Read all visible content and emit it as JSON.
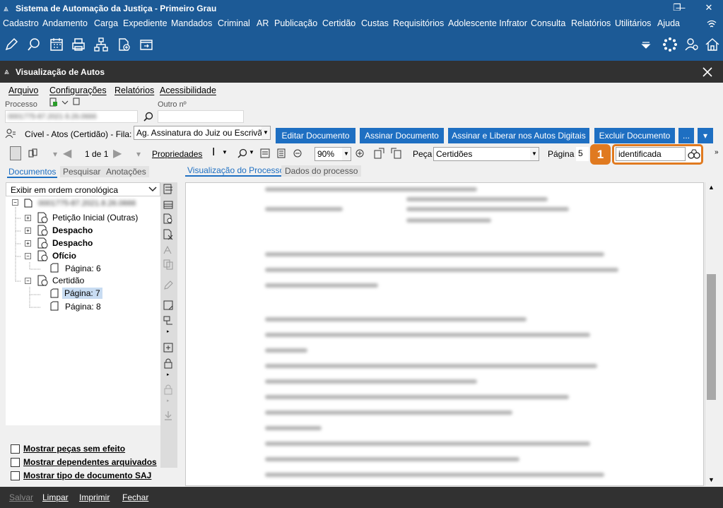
{
  "window": {
    "title": "Sistema de Automação da Justiça - Primeiro Grau",
    "logo_glyph": "⩓"
  },
  "menubar": [
    "Cadastro",
    "Andamento",
    "Carga",
    "Expediente",
    "Mandados",
    "Criminal",
    "AR",
    "Publicação",
    "Certidão",
    "Custas",
    "Requisitórios",
    "Adolescente Infrator",
    "Consulta",
    "Relatórios",
    "Utilitários",
    "Ajuda"
  ],
  "inner_window": {
    "title": "Visualização de Autos"
  },
  "inner_menu": [
    "Arquivo",
    "Configurações",
    "Relatórios",
    "Acessibilidade"
  ],
  "processo": {
    "label": "Processo",
    "value_blurred": "0001775-87.2021 8.26.0666",
    "outro_label": "Outro nº",
    "outro_value": ""
  },
  "fila": {
    "prefix": "Cível - Atos (Certidão) - Fila:",
    "selected": "Ag. Assinatura do Juiz ou Escrivão"
  },
  "action_buttons": {
    "editar": "Editar Documento",
    "assinar": "Assinar Documento",
    "assinar_liberar": "Assinar e Liberar nos Autos Digitais",
    "excluir": "Excluir Documento",
    "more": "...",
    "expand": "▾"
  },
  "viewer_toolbar": {
    "page_counter": "1 de 1",
    "propriedades": "Propriedades",
    "zoom": "90%",
    "peca_label": "Peça",
    "peca_value": "Certidões",
    "pagina_label": "Página",
    "pagina_value": "5",
    "search_value": "identificada",
    "callout_number": "1"
  },
  "left_tabs": [
    "Documentos",
    "Pesquisar",
    "Anotações"
  ],
  "order_select": "Exibir em ordem cronológica",
  "tree": {
    "root": "0001775-87.2021.8.26.0666",
    "items": [
      {
        "label": "Petição Inicial (Outras)",
        "bold": false
      },
      {
        "label": "Despacho",
        "bold": true
      },
      {
        "label": "Despacho",
        "bold": true
      },
      {
        "label": "Ofício",
        "bold": true
      },
      {
        "label": "Página: 6",
        "bold": false
      },
      {
        "label": "Certidão",
        "bold": false
      },
      {
        "label": "Página: 7",
        "bold": false,
        "selected": true
      },
      {
        "label": "Página: 8",
        "bold": false
      }
    ]
  },
  "right_tabs": [
    "Visualização do Processo",
    "Dados do processo"
  ],
  "checkboxes": [
    "Mostrar peças sem efeito",
    "Mostrar dependentes arquivados",
    "Mostrar tipo de documento SAJ"
  ],
  "statusbar": [
    "Salvar",
    "Limpar",
    "Imprimir",
    "Fechar"
  ],
  "colors": {
    "title_blue": "#1c5a96",
    "button_blue": "#1e6fc2",
    "highlight_orange": "#e07a20",
    "dark_bar": "#313131"
  }
}
